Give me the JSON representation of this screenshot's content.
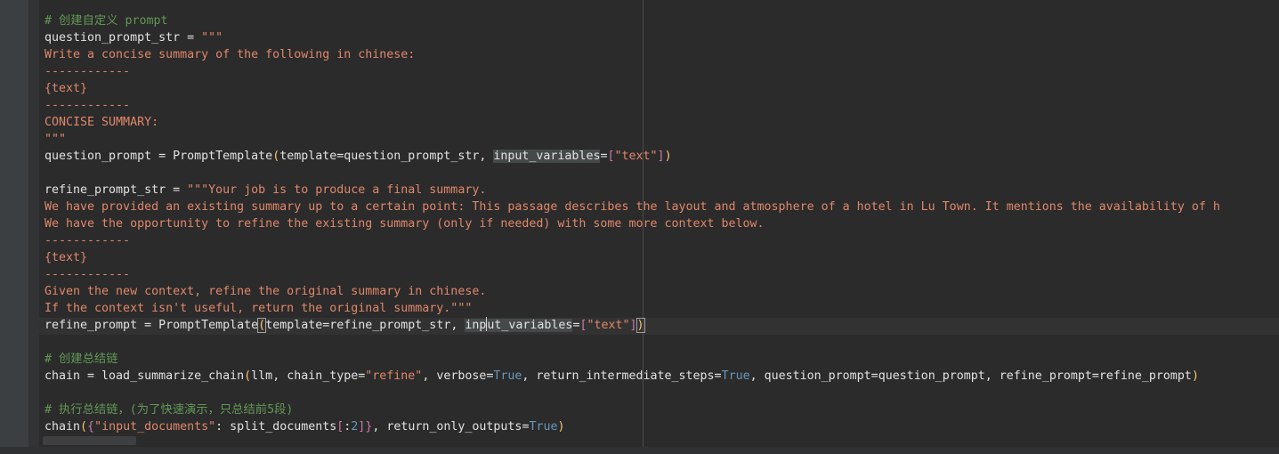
{
  "editor": {
    "lines": [
      [
        {
          "t": "comment",
          "v": "# 创建自定义 prompt"
        }
      ],
      [
        {
          "t": "id",
          "v": "question_prompt_str = "
        },
        {
          "t": "str",
          "v": "\"\"\""
        }
      ],
      [
        {
          "t": "str",
          "v": "Write a concise summary of the following in chinese:"
        }
      ],
      [
        {
          "t": "str",
          "v": "------------"
        }
      ],
      [
        {
          "t": "str",
          "v": "{text}"
        }
      ],
      [
        {
          "t": "str",
          "v": "------------"
        }
      ],
      [
        {
          "t": "str",
          "v": "CONCISE SUMMARY:"
        }
      ],
      [
        {
          "t": "str",
          "v": "\"\"\""
        }
      ],
      [
        {
          "t": "id",
          "v": "question_prompt = PromptTemplate"
        },
        {
          "t": "bracket",
          "v": "("
        },
        {
          "t": "id",
          "v": "template=question_prompt_str, "
        },
        {
          "t": "id",
          "v": "input_variables",
          "hl": true
        },
        {
          "t": "id",
          "v": "="
        },
        {
          "t": "bracket2",
          "v": "["
        },
        {
          "t": "str",
          "v": "\"text\""
        },
        {
          "t": "bracket2",
          "v": "]"
        },
        {
          "t": "bracket",
          "v": ")"
        }
      ],
      [],
      [
        {
          "t": "id",
          "v": "refine_prompt_str = "
        },
        {
          "t": "str",
          "v": "\"\"\"Your job is to produce a final summary."
        }
      ],
      [
        {
          "t": "str",
          "v": "We have provided an existing summary up to a certain point: This passage describes the layout and atmosphere of a hotel in Lu Town. It mentions the availability of h"
        }
      ],
      [
        {
          "t": "str",
          "v": "We have the opportunity to refine the existing summary (only if needed) with some more context below."
        }
      ],
      [
        {
          "t": "str",
          "v": "------------"
        }
      ],
      [
        {
          "t": "str",
          "v": "{text}"
        }
      ],
      [
        {
          "t": "str",
          "v": "------------"
        }
      ],
      [
        {
          "t": "str",
          "v": "Given the new context, refine the original summary in chinese."
        }
      ],
      [
        {
          "t": "str",
          "v": "If the context isn't useful, return the original summary.\"\"\""
        }
      ],
      [
        {
          "t": "id",
          "v": "refine_prompt = PromptTemplate"
        },
        {
          "t": "bracket-match",
          "v": "("
        },
        {
          "t": "id",
          "v": "template=refine_prompt_str, "
        },
        {
          "t": "id",
          "v": "inp",
          "hl": true
        },
        {
          "t": "caret",
          "v": ""
        },
        {
          "t": "id",
          "v": "ut_variables",
          "hl": true
        },
        {
          "t": "id",
          "v": "="
        },
        {
          "t": "bracket2",
          "v": "["
        },
        {
          "t": "str",
          "v": "\"text\""
        },
        {
          "t": "bracket2",
          "v": "]"
        },
        {
          "t": "bracket-match",
          "v": ")"
        }
      ],
      [],
      [
        {
          "t": "comment",
          "v": "# 创建总结链"
        }
      ],
      [
        {
          "t": "id",
          "v": "chain = load_summarize_chain"
        },
        {
          "t": "bracket",
          "v": "("
        },
        {
          "t": "id",
          "v": "llm, chain_type="
        },
        {
          "t": "str",
          "v": "\"refine\""
        },
        {
          "t": "id",
          "v": ", verbose="
        },
        {
          "t": "bool",
          "v": "True"
        },
        {
          "t": "id",
          "v": ", return_intermediate_steps="
        },
        {
          "t": "bool",
          "v": "True"
        },
        {
          "t": "id",
          "v": ", question_prompt=question_prompt, refine_prompt=refine_prompt"
        },
        {
          "t": "bracket",
          "v": ")"
        }
      ],
      [],
      [
        {
          "t": "comment",
          "v": "# 执行总结链，(为了快速演示，只总结前5段)"
        }
      ],
      [
        {
          "t": "id",
          "v": "chain"
        },
        {
          "t": "bracket",
          "v": "("
        },
        {
          "t": "bracket2",
          "v": "{"
        },
        {
          "t": "str",
          "v": "\"input_documents\""
        },
        {
          "t": "id",
          "v": ": split_documents"
        },
        {
          "t": "bracket2",
          "v": "["
        },
        {
          "t": "id",
          "v": ":"
        },
        {
          "t": "num",
          "v": "2"
        },
        {
          "t": "bracket2",
          "v": "]"
        },
        {
          "t": "bracket2",
          "v": "}"
        },
        {
          "t": "id",
          "v": ", return_only_outputs="
        },
        {
          "t": "bool",
          "v": "True"
        },
        {
          "t": "bracket",
          "v": ")"
        }
      ]
    ]
  },
  "colors": {
    "background": "#2b2b2b",
    "comment": "#629755",
    "identifier": "#e2e2e2",
    "string": "#e0876a",
    "boolean": "#6897bb",
    "bracket": "#ffc66d",
    "bracket_nested": "#cc78a8"
  }
}
